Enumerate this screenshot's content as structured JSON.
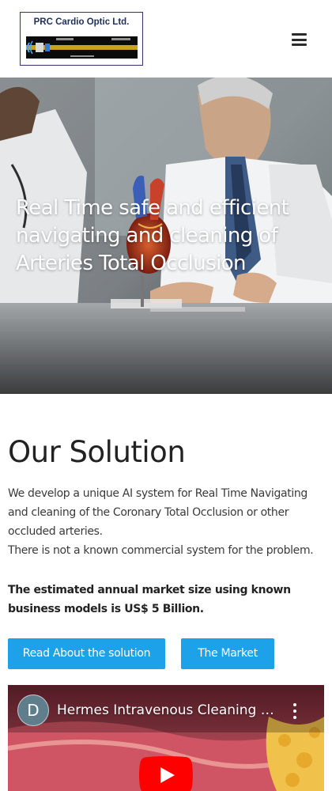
{
  "header": {
    "logo_text": "PRC Cardio Optic Ltd.",
    "menu_icon": "hamburger-menu-icon"
  },
  "hero": {
    "title": "Real Time safe and efficient navigating and cleaning of Arteries Total Occlusion"
  },
  "solution": {
    "title": "Our Solution",
    "paragraph_1": "We develop a unique AI system for Real Time Navigating and cleaning of the Coronary Total Occlusion or other occluded arteries.",
    "paragraph_2": "There is not a known commercial system for the problem.",
    "paragraph_bold": "The estimated annual market size using known business models is US$ 5 Billion."
  },
  "buttons": {
    "read_solution": "Read About the solution",
    "market": "The Market"
  },
  "video": {
    "avatar_letter": "D",
    "title": "Hermes Intravenous Cleaning Sy...",
    "play_icon": "play-icon",
    "more_icon": "more-vertical-icon"
  },
  "colors": {
    "accent": "#1da1e8",
    "heading": "#222222",
    "body_text": "#3a3a3a",
    "logo_border": "#30346a",
    "video_avatar": "#607d8b",
    "play_button": "#ff0000"
  }
}
